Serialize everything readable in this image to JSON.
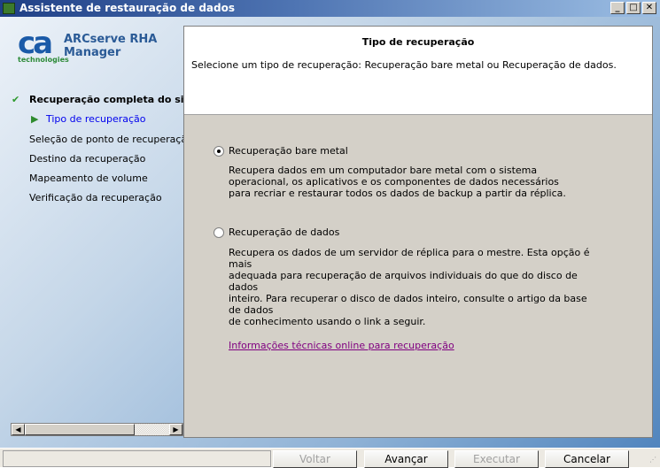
{
  "window": {
    "title": "Assistente de restauração de dados",
    "controls": [
      "_",
      "□",
      "✕"
    ]
  },
  "logo": {
    "mark": "ca",
    "sub": "technologies",
    "product_line1": "ARCserve RHA",
    "product_line2": "Manager"
  },
  "steps": {
    "parent": "Recuperação completa do sistema",
    "items": [
      "Tipo de recuperação",
      "Seleção de ponto de recuperação",
      "Destino da recuperação",
      "Mapeamento de volume",
      "Verificação da recuperação"
    ]
  },
  "header": {
    "title": "Tipo de recuperação",
    "subtitle": "Selecione um tipo de recuperação: Recuperação bare metal ou Recuperação de dados."
  },
  "options": [
    {
      "label": "Recuperação bare metal",
      "selected": true,
      "description": [
        "Recupera dados em um computador bare metal com o sistema",
        "operacional, os aplicativos e os componentes de dados necessários",
        "para recriar e restaurar todos os dados de backup a partir da réplica."
      ]
    },
    {
      "label": "Recuperação de dados",
      "selected": false,
      "description": [
        "Recupera os dados de um servidor de réplica para o mestre. Esta opção é mais",
        "adequada para recuperação de arquivos individuais do que do disco de dados",
        "inteiro. Para recuperar o disco de dados inteiro, consulte o artigo da base de dados",
        "de conhecimento usando o link a seguir."
      ]
    }
  ],
  "link": "Informações técnicas online para recuperação",
  "buttons": {
    "back": "Voltar",
    "next": "Avançar",
    "run": "Executar",
    "cancel": "Cancelar"
  }
}
